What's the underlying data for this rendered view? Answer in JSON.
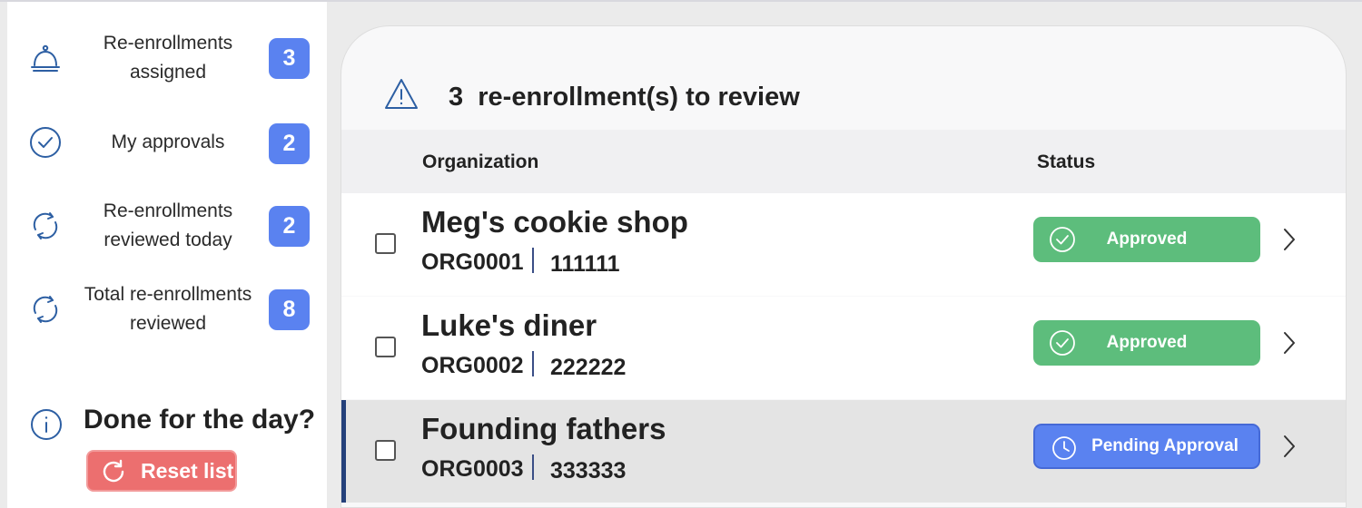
{
  "sidebar": {
    "stats": [
      {
        "label": "Re-enrollments assigned",
        "count": "3",
        "icon": "service-bell-icon"
      },
      {
        "label": "My approvals",
        "count": "2",
        "icon": "check-circle-icon"
      },
      {
        "label": "Re-enrollments reviewed today",
        "count": "2",
        "icon": "refresh-icon"
      },
      {
        "label": "Total re-enrollments reviewed",
        "count": "8",
        "icon": "refresh-icon"
      }
    ],
    "done_text": "Done for the day?",
    "reset_label": "Reset list"
  },
  "review": {
    "count": "3",
    "title_suffix": "re-enrollment(s) to review",
    "columns": {
      "organization": "Organization",
      "status": "Status"
    },
    "rows": [
      {
        "name": "Meg's cookie shop",
        "org_id": "ORG0001",
        "number": "111111",
        "status": "Approved",
        "status_type": "approved"
      },
      {
        "name": "Luke's diner",
        "org_id": "ORG0002",
        "number": "222222",
        "status": "Approved",
        "status_type": "approved"
      },
      {
        "name": "Founding fathers",
        "org_id": "ORG0003",
        "number": "333333",
        "status": "Pending Approval",
        "status_type": "pending"
      }
    ]
  },
  "colors": {
    "badge": "#5a82f0",
    "approved": "#5dbd7c",
    "pending": "#5a82f0",
    "reset": "#ec6f6f",
    "icon_stroke": "#2d5fa3"
  }
}
